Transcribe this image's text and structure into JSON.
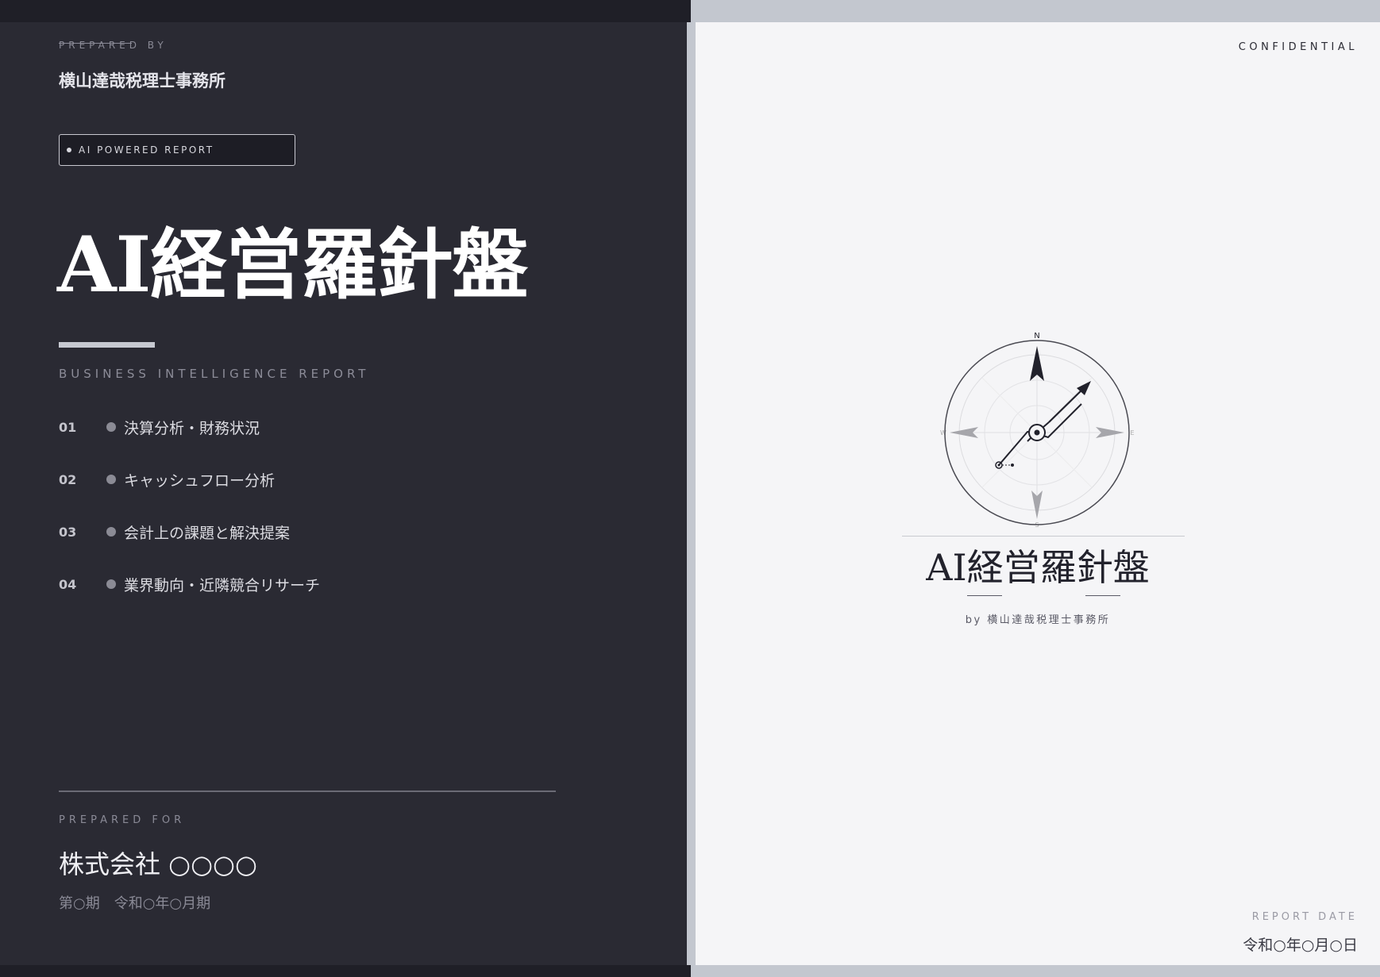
{
  "left": {
    "prepared_by_label": "PREPARED BY",
    "firm_name": "横山達哉税理士事務所",
    "badge_text": "AI POWERED REPORT",
    "title": "AI経営羅針盤",
    "subtitle": "BUSINESS INTELLIGENCE REPORT",
    "toc": [
      {
        "num": "01",
        "label": "決算分析・財務状況"
      },
      {
        "num": "02",
        "label": "キャッシュフロー分析"
      },
      {
        "num": "03",
        "label": "会計上の課題と解決提案"
      },
      {
        "num": "04",
        "label": "業界動向・近隣競合リサーチ"
      }
    ],
    "prepared_for_label": "PREPARED FOR",
    "client_name": "株式会社 ○○○○",
    "period": "第○期　令和○年○月期"
  },
  "right": {
    "confidential": "CONFIDENTIAL",
    "compass": {
      "north": "N",
      "south": "S",
      "east": "E",
      "west": "W"
    },
    "title": "AI経営羅針盤",
    "byline": "by 横山達哉税理士事務所",
    "report_date_label": "REPORT DATE",
    "report_date": "令和○年○月○日"
  },
  "colors": {
    "dark_panel": "#2a2a33",
    "light_panel": "#f5f5f7",
    "accent_gray": "#c7c9d1"
  }
}
